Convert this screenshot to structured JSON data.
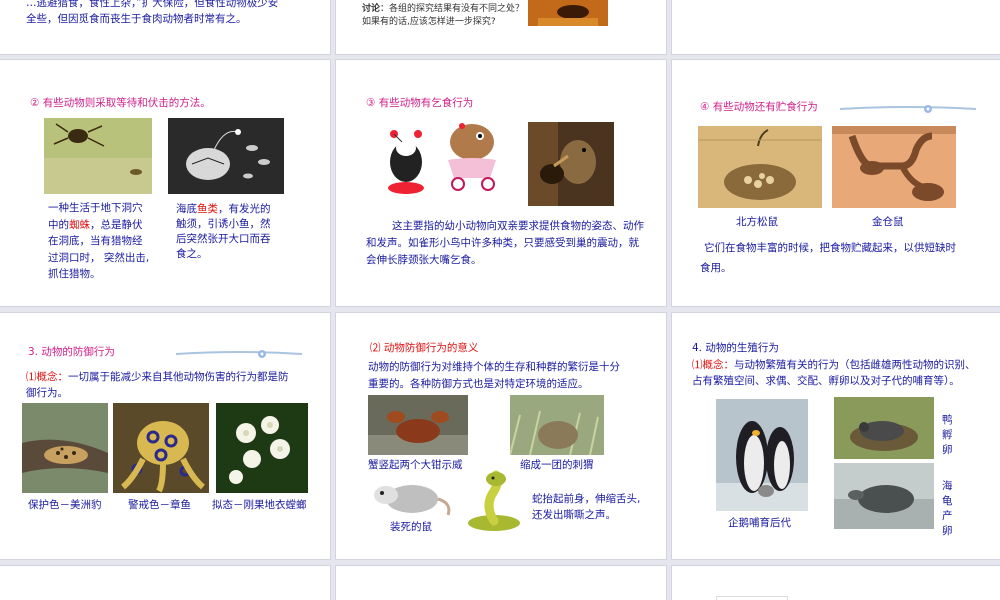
{
  "s1": {
    "line1": "…逃避猎食，食性上杂，”扩大保险，但食性动物极少安",
    "line2": "全些，但因觅食而丧生于食肉动物者时常有之。"
  },
  "s2": {
    "discuss_label": "讨论",
    "discuss1": "：各组的探究结果有没有不同之处？",
    "discuss2": "如果有的话,应该怎样进一步探究?"
  },
  "s4": {
    "title": "② 有些动物则采取等待和伏击的方法。",
    "left_l1_a": "一种生活于地下洞穴",
    "left_l2_a": "中的",
    "left_l2_red": "蜘蛛",
    "left_l2_b": "，总是静伏",
    "left_l3": "在洞底，当有猎物经",
    "left_l4": "过洞口时， 突然出击,",
    "left_l5": "抓住猎物。",
    "right_l1_a": "海底",
    "right_l1_red": "鱼类",
    "right_l1_b": "，有发光的",
    "right_l2": "触须，引诱小鱼，然",
    "right_l3": "后突然张开大口而吞",
    "right_l4": "食之。"
  },
  "s5": {
    "title": "③ 有些动物有乞食行为",
    "p1": "这主要指的幼小动物向双亲要求提供食物的姿态、动作",
    "p2": "和发声。如雀形小鸟中许多种类，只要感受到巢的震动，就",
    "p3": "会伸长脖颈张大嘴乞食。"
  },
  "s6": {
    "title": "④ 有些动物还有贮食行为",
    "cap1": "北方松鼠",
    "cap2": "金仓鼠",
    "p1": "它们在食物丰富的时候，把食物贮藏起来，以供短缺时",
    "p2": "食用。"
  },
  "s7": {
    "title": "3. 动物的防御行为",
    "concept_num": "⑴",
    "concept_label": "概念：",
    "p1": "一切属于能减少来自其他动物伤害的行为都是防",
    "p2": "御行为。",
    "cap1": "保护色－美洲豹",
    "cap2": "警戒色－章鱼",
    "cap3": "拟态－刚果地衣螳螂"
  },
  "s8": {
    "title": "⑵ 动物防御行为的意义",
    "p1": "动物的防御行为对维持个体的生存和种群的繁衍是十分",
    "p2": "重要的。各种防御方式也是对特定环境的适应。",
    "cap1": "蟹竖起两个大钳示威",
    "cap2": "缩成一团的刺猬",
    "cap3": "装死的鼠",
    "snake1": "蛇抬起前身，伸缩舌头,",
    "snake2": "还发出嘶嘶之声。"
  },
  "s9": {
    "title": "4. 动物的生殖行为",
    "concept_num": "⑴",
    "concept_label": "概念：",
    "p1": "与动物繁殖有关的行为（包括雌雄两性动物的识别、",
    "p2": "占有繁殖空间、求偶、交配、孵卵以及对子代的哺育等）。",
    "cap1": "企鹅哺育后代",
    "v1": "鸭",
    "v2": "孵",
    "v3": "卵",
    "w1": "海",
    "w2": "龟",
    "w3": "产",
    "w4": "卵"
  },
  "colors": {
    "title_magenta": "#d0208a",
    "body_blue": "#1a1aa0",
    "highlight_red": "#e01010",
    "background": "#e6e6ee"
  }
}
